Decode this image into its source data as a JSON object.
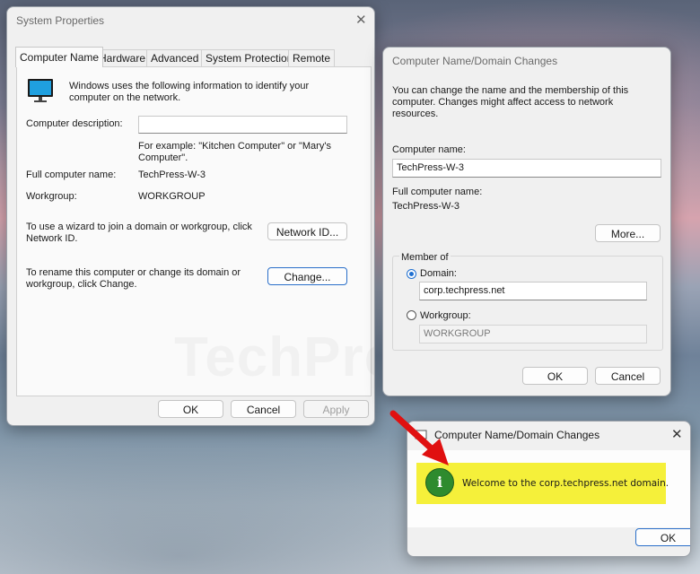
{
  "system_properties": {
    "title": "System Properties",
    "tabs": [
      "Computer Name",
      "Hardware",
      "Advanced",
      "System Protection",
      "Remote"
    ],
    "intro": "Windows uses the following information to identify your computer on the network.",
    "desc_label": "Computer description:",
    "desc_value": "",
    "example": "For example: \"Kitchen Computer\" or \"Mary's Computer\".",
    "full_name_label": "Full computer name:",
    "full_name_value": "TechPress-W-3",
    "workgroup_label": "Workgroup:",
    "workgroup_value": "WORKGROUP",
    "wizard_text": "To use a wizard to join a domain or workgroup, click Network ID.",
    "network_id_btn": "Network ID...",
    "rename_text": "To rename this computer or change its domain or workgroup, click Change.",
    "change_btn": "Change...",
    "ok": "OK",
    "cancel": "Cancel",
    "apply": "Apply",
    "watermark": "TechPress.net"
  },
  "name_changes": {
    "title": "Computer Name/Domain Changes",
    "intro": "You can change the name and the membership of this computer. Changes might affect access to network resources.",
    "computer_name_label": "Computer name:",
    "computer_name_value": "TechPress-W-3",
    "full_name_label": "Full computer name:",
    "full_name_value": "TechPress-W-3",
    "more_btn": "More...",
    "member_of": "Member of",
    "domain_label": "Domain:",
    "domain_value": "corp.techpress.net",
    "workgroup_label": "Workgroup:",
    "workgroup_value": "WORKGROUP",
    "ok": "OK",
    "cancel": "Cancel"
  },
  "welcome": {
    "title": "Computer Name/Domain Changes",
    "message": "Welcome to the corp.techpress.net domain.",
    "ok": "OK",
    "highlight_color": "#f5f03a",
    "info_icon_color": "#2e8b2e"
  },
  "colors": {
    "accent": "#1f6fd0",
    "arrow": "#e01010"
  }
}
